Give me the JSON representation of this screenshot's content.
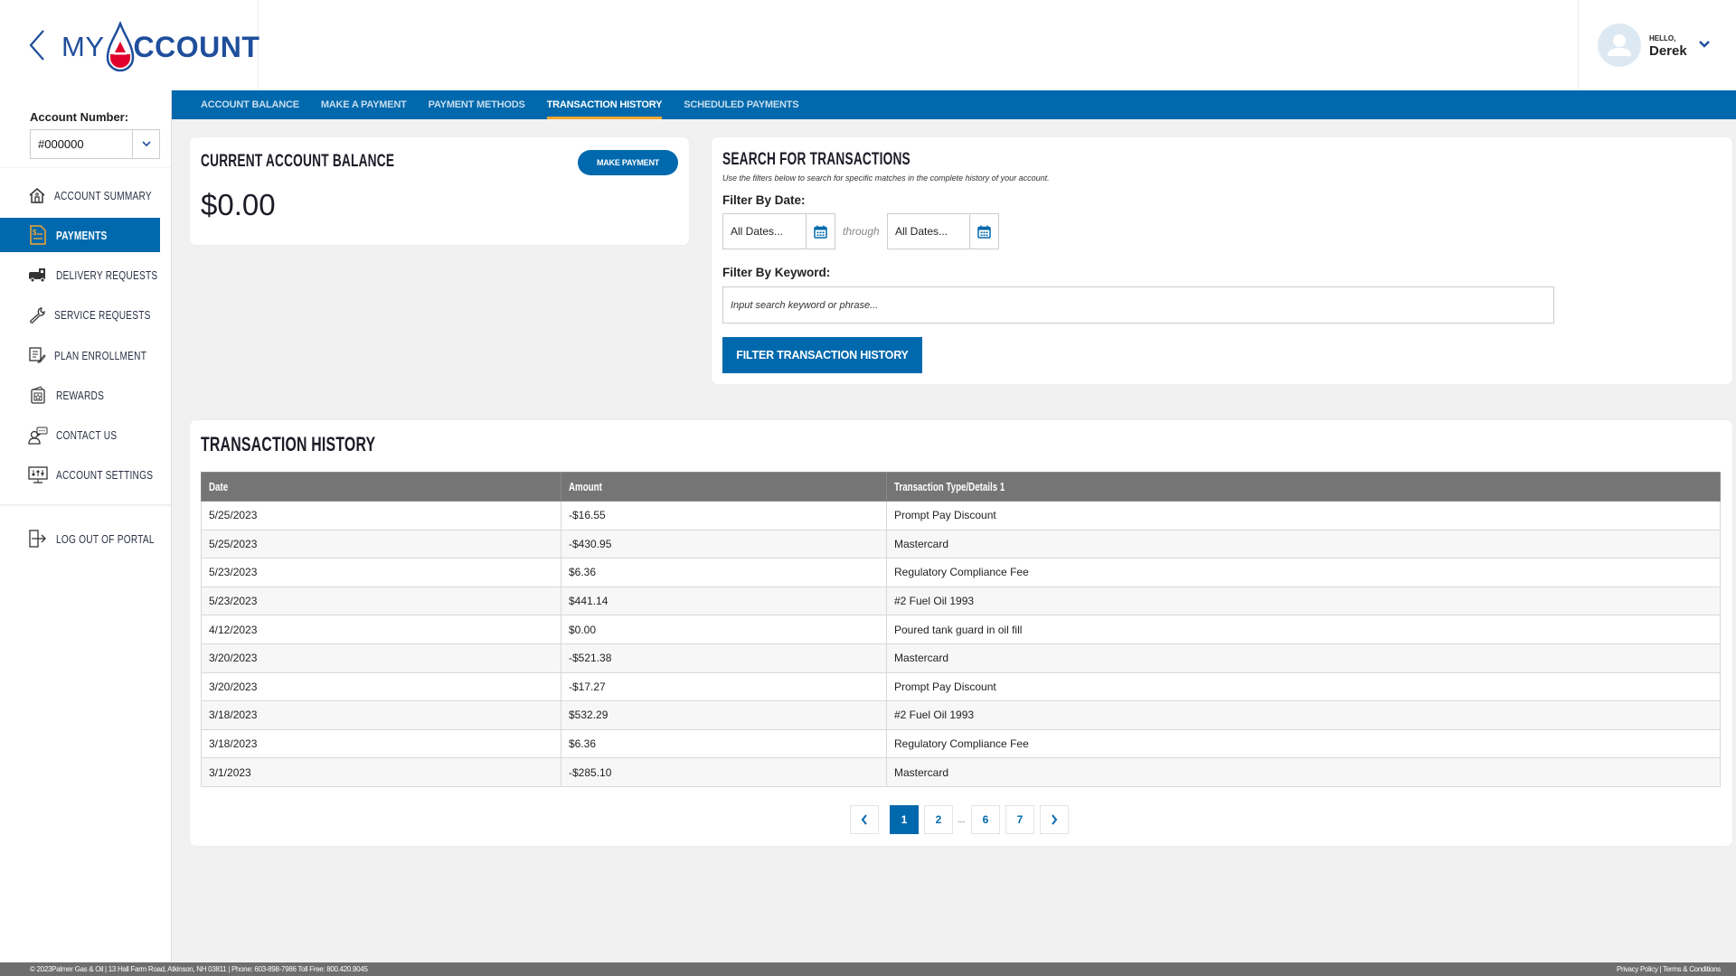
{
  "header": {
    "logo_text_my": "MY",
    "logo_text_account": "CCOUNT",
    "greeting": "HELLO,",
    "username": "Derek"
  },
  "topnav": {
    "tabs": [
      {
        "label": "ACCOUNT BALANCE",
        "active": false
      },
      {
        "label": "MAKE A PAYMENT",
        "active": false
      },
      {
        "label": "PAYMENT METHODS",
        "active": false
      },
      {
        "label": "TRANSACTION HISTORY",
        "active": true
      },
      {
        "label": "SCHEDULED PAYMENTS",
        "active": false
      }
    ]
  },
  "sidebar": {
    "account_label": "Account Number:",
    "account_value": "#000000",
    "items": [
      {
        "label": "ACCOUNT SUMMARY",
        "icon": "house-icon"
      },
      {
        "label": "PAYMENTS",
        "icon": "invoice-dollar-icon",
        "active": true
      },
      {
        "label": "DELIVERY REQUESTS",
        "icon": "truck-icon"
      },
      {
        "label": "SERVICE REQUESTS",
        "icon": "wrench-icon"
      },
      {
        "label": "PLAN ENROLLMENT",
        "icon": "document-pen-icon"
      },
      {
        "label": "REWARDS",
        "icon": "rewards-icon"
      },
      {
        "label": "CONTACT US",
        "icon": "contact-chat-icon"
      },
      {
        "label": "ACCOUNT SETTINGS",
        "icon": "settings-monitor-icon"
      }
    ],
    "logout_label": "LOG OUT OF PORTAL"
  },
  "balance": {
    "title": "CURRENT ACCOUNT BALANCE",
    "amount": "$0.00",
    "button_label": "MAKE PAYMENT"
  },
  "search": {
    "title": "SEARCH FOR TRANSACTIONS",
    "description": "Use the filters below to search for specific matches in the complete history of your account.",
    "date_label": "Filter By Date:",
    "date_from": "All Dates...",
    "through": "through",
    "date_to": "All Dates...",
    "keyword_label": "Filter By Keyword:",
    "keyword_value": "",
    "keyword_placeholder": "Input search keyword or phrase...",
    "button_label": "FILTER TRANSACTION HISTORY"
  },
  "history": {
    "title": "TRANSACTION HISTORY",
    "columns": [
      "Date",
      "Amount",
      "Transaction Type/Details 1"
    ],
    "rows": [
      [
        "5/25/2023",
        "-$16.55",
        "Prompt Pay Discount"
      ],
      [
        "5/25/2023",
        "-$430.95",
        "Mastercard"
      ],
      [
        "5/23/2023",
        "$6.36",
        "Regulatory Compliance Fee"
      ],
      [
        "5/23/2023",
        "$441.14",
        "#2 Fuel Oil 1993"
      ],
      [
        "4/12/2023",
        "$0.00",
        "Poured tank guard in oil fill"
      ],
      [
        "3/20/2023",
        "-$521.38",
        "Mastercard"
      ],
      [
        "3/20/2023",
        "-$17.27",
        "Prompt Pay Discount"
      ],
      [
        "3/18/2023",
        "$532.29",
        "#2 Fuel Oil 1993"
      ],
      [
        "3/18/2023",
        "$6.36",
        "Regulatory Compliance Fee"
      ],
      [
        "3/1/2023",
        "-$285.10",
        "Mastercard"
      ]
    ],
    "pagination": {
      "current": "1",
      "pages": [
        "1",
        "2",
        "...",
        "6",
        "7"
      ]
    }
  },
  "footer": {
    "left": "© 2023Palmer Gas & Oil  |   13 Hall Farm Road, Atkinson, NH 03811   |   Phone: 603-898-7986   Toll Free: 800.420.9045",
    "privacy": "Privacy Policy",
    "separator": "|",
    "terms": "Terms & Conditions"
  },
  "colors": {
    "brand_blue": "#0069ad",
    "logo_blue": "#1f4e9c",
    "logo_red": "#e0002b",
    "active_tab_underline": "#f6a531",
    "table_header": "#757575",
    "footer": "#6e6e6e"
  }
}
